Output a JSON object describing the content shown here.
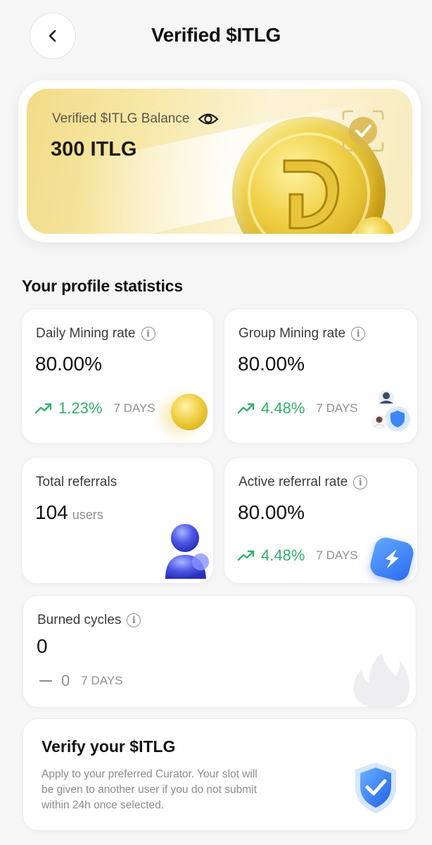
{
  "header": {
    "title": "Verified $ITLG"
  },
  "balance": {
    "label": "Verified $ITLG Balance",
    "value": "300 ITLG"
  },
  "section_title": "Your profile statistics",
  "stats": {
    "daily_mining": {
      "label": "Daily Mining rate",
      "value": "80.00%",
      "change": "1.23%",
      "period": "7 DAYS"
    },
    "group_mining": {
      "label": "Group Mining rate",
      "value": "80.00%",
      "change": "4.48%",
      "period": "7 DAYS"
    },
    "total_referrals": {
      "label": "Total referrals",
      "value": "104",
      "unit": "users"
    },
    "active_referral": {
      "label": "Active referral rate",
      "value": "80.00%",
      "change": "4.48%",
      "period": "7 DAYS"
    },
    "burned_cycles": {
      "label": "Burned cycles",
      "value": "0",
      "change": "0",
      "period": "7 DAYS"
    }
  },
  "verify": {
    "title": "Verify your $ITLG",
    "description": "Apply to your preferred Curator. Your slot will be given to another user if you do not submit within 24h once selected."
  },
  "colors": {
    "positive": "#33b06b",
    "accent_blue": "#2a6bf0",
    "gold": "#e9c63a"
  },
  "icons": [
    "back-arrow-icon",
    "eye-icon",
    "info-icon",
    "trend-up-icon",
    "dash-icon",
    "coin-icon",
    "shield-check-icon",
    "lightning-icon",
    "flame-icon",
    "user-3d-icon"
  ]
}
